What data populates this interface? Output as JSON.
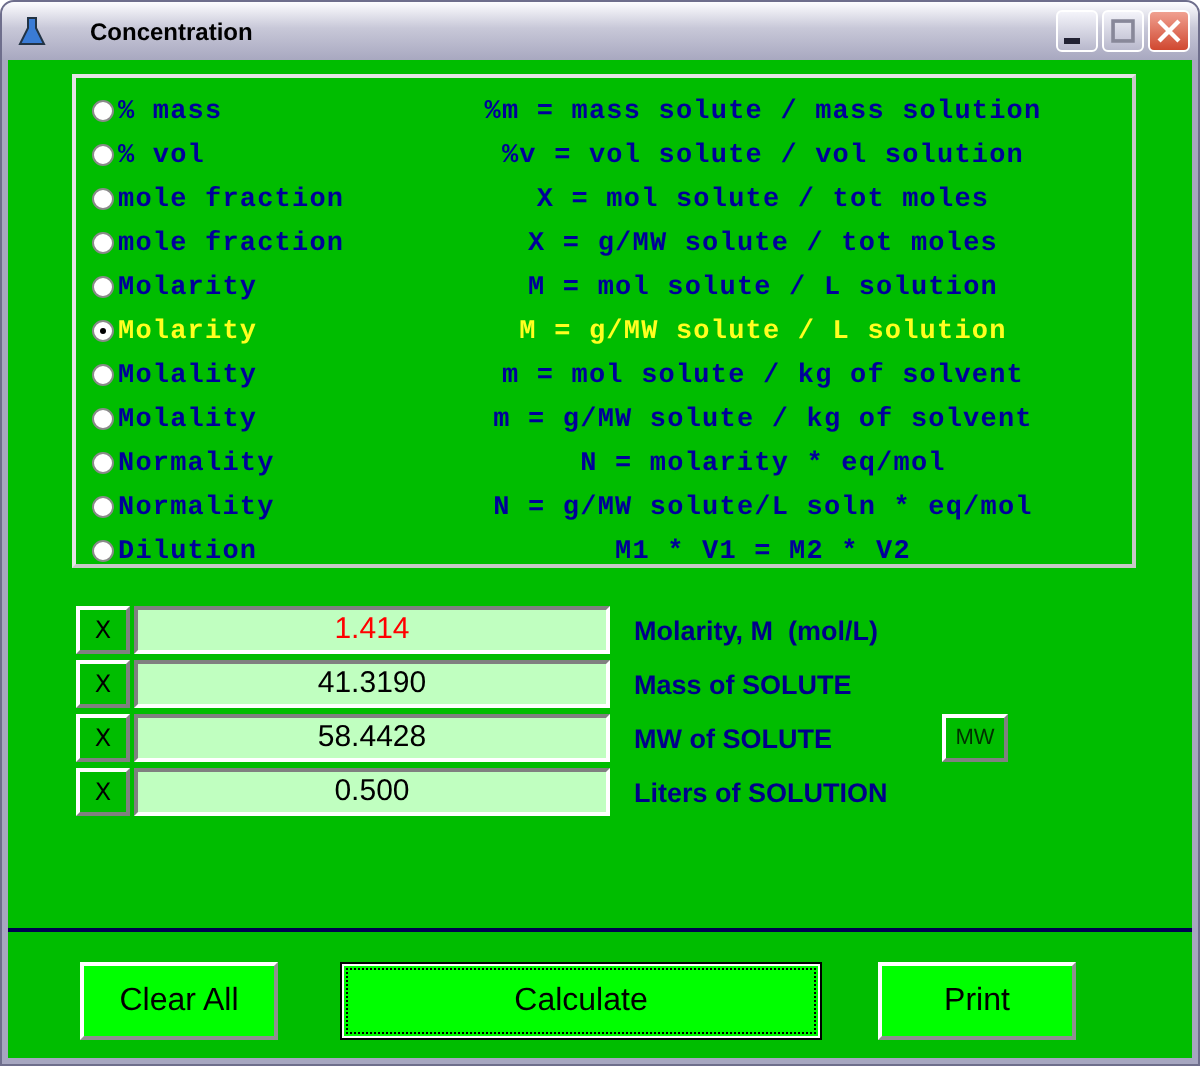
{
  "window": {
    "title": "Concentration"
  },
  "options": [
    {
      "label": "% mass",
      "formula": "%m = mass solute / mass solution",
      "selected": false
    },
    {
      "label": "% vol",
      "formula": "%v = vol solute / vol solution",
      "selected": false
    },
    {
      "label": "mole fraction",
      "formula": "X = mol solute / tot moles",
      "selected": false
    },
    {
      "label": "mole fraction",
      "formula": "X = g/MW solute / tot moles",
      "selected": false
    },
    {
      "label": "Molarity",
      "formula": "M = mol solute / L solution",
      "selected": false
    },
    {
      "label": "Molarity",
      "formula": "M = g/MW solute / L solution",
      "selected": true
    },
    {
      "label": "Molality",
      "formula": "m = mol solute / kg of solvent",
      "selected": false
    },
    {
      "label": "Molality",
      "formula": "m = g/MW solute / kg of solvent",
      "selected": false
    },
    {
      "label": "Normality",
      "formula": "N = molarity * eq/mol",
      "selected": false
    },
    {
      "label": "Normality",
      "formula": "N = g/MW solute/L soln * eq/mol",
      "selected": false
    },
    {
      "label": "Dilution",
      "formula": "M1 * V1 = M2 * V2",
      "selected": false
    }
  ],
  "fields": [
    {
      "clear": "X",
      "value": "1.414",
      "label": "Molarity, M  (mol/L)",
      "computed": true
    },
    {
      "clear": "X",
      "value": "41.3190",
      "label": "Mass of SOLUTE",
      "computed": false
    },
    {
      "clear": "X",
      "value": "58.4428",
      "label": "MW of SOLUTE",
      "computed": false,
      "button": "MW"
    },
    {
      "clear": "X",
      "value": "0.500",
      "label": "Liters of SOLUTION",
      "computed": false
    }
  ],
  "buttons": [
    {
      "label": "Clear All",
      "default": false
    },
    {
      "label": "Calculate",
      "default": true
    },
    {
      "label": "Print",
      "default": false
    }
  ]
}
